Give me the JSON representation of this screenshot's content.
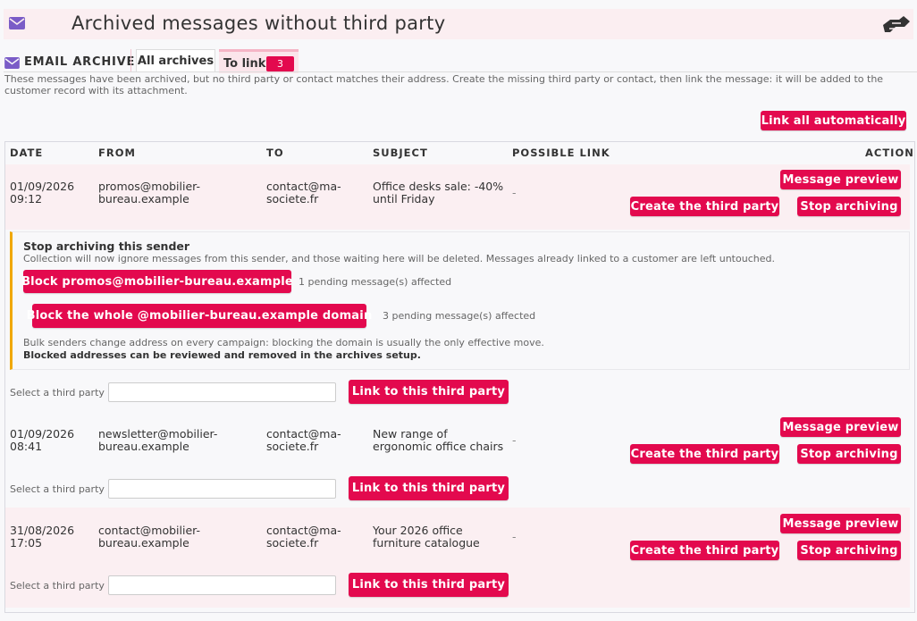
{
  "header": {
    "title": "Archived messages without third party",
    "icon": "envelope-icon",
    "right_icon": "hand-link-icon"
  },
  "tabs": {
    "module_label": "EMAIL ARCHIVE",
    "all_archives": "All archives",
    "to_link": "To link",
    "to_link_count": "3"
  },
  "intro": "These messages have been archived, but no third party or contact matches their address. Create the missing third party or contact, then link the message: it will be added to the customer record with its attachment.",
  "actions": {
    "link_all": "Link all automatically"
  },
  "columns": {
    "date": "DATE",
    "from": "FROM",
    "to": "TO",
    "subject": "SUBJECT",
    "possible_link": "POSSIBLE LINK",
    "action": "ACTION"
  },
  "row_buttons": {
    "preview": "Message preview",
    "create": "Create the third party",
    "stop": "Stop archiving",
    "select_label": "Select a third party",
    "link": "Link to this third party"
  },
  "rows": [
    {
      "date1": "01/09/2026",
      "date2": "09:12",
      "from1": "promos@mobilier-",
      "from2": "bureau.example",
      "to1": "contact@ma-",
      "to2": "societe.fr",
      "subj1": "Office desks sale: -40%",
      "subj2": "until Friday",
      "link": "-"
    },
    {
      "date1": "01/09/2026",
      "date2": "08:41",
      "from1": "newsletter@mobilier-",
      "from2": "bureau.example",
      "to1": "contact@ma-",
      "to2": "societe.fr",
      "subj1": "New range of",
      "subj2": "ergonomic office chairs",
      "link": "-"
    },
    {
      "date1": "31/08/2026",
      "date2": "17:05",
      "from1": "contact@mobilier-",
      "from2": "bureau.example",
      "to1": "contact@ma-",
      "to2": "societe.fr",
      "subj1": "Your 2026 office",
      "subj2": "furniture catalogue",
      "link": "-"
    }
  ],
  "stop_panel": {
    "title": "Stop archiving this sender",
    "desc": "Collection will now ignore messages from this sender, and those waiting here will be deleted. Messages already linked to a customer are left untouched.",
    "block_address": "Block promos@mobilier-bureau.example",
    "block_address_note": "1 pending message(s) affected",
    "block_domain": "Block the whole @mobilier-bureau.example domain",
    "block_domain_note": "3 pending message(s) affected",
    "hint": "Bulk senders change address on every campaign: blocking the domain is usually the only effective move.",
    "hint_bold": "Blocked addresses can be reviewed and removed in the archives setup."
  },
  "colors": {
    "accent": "#e3094e",
    "envelope": "#7a5cc7",
    "warning": "#f0a800",
    "row_tint": "#fbeff2"
  }
}
